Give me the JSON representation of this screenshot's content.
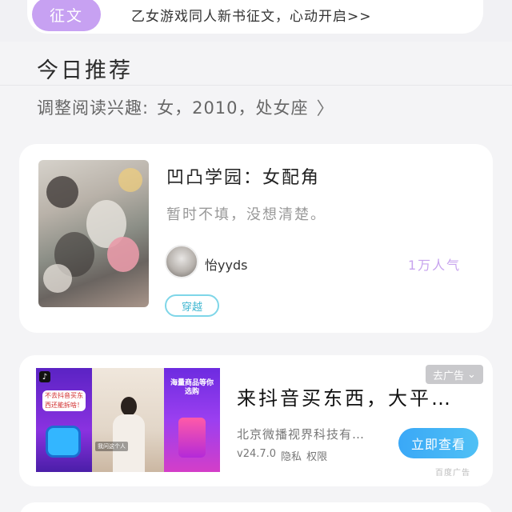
{
  "top_banner": {
    "tag": "征文",
    "text": "乙女游戏同人新书征文，心动开启>>"
  },
  "section": {
    "title": "今日推荐",
    "interest_prefix": "调整阅读兴趣:",
    "interest_values": "女，2010，处女座",
    "chevron_icon": "chevron-right-icon"
  },
  "book": {
    "title": "凹凸学园：女配角",
    "description": "暂时不填，没想清楚。",
    "author": "怡yyds",
    "popularity": "1万人气",
    "genre": "穿越"
  },
  "ad": {
    "close_label": "去广告",
    "title": "来抖音买东西，大平…",
    "company": "北京微播视界科技有…",
    "version": "v24.7.0",
    "privacy": "隐私",
    "permissions": "权限",
    "cta": "立即查看",
    "source": "百度广告",
    "image_texts": {
      "left_bubble": "不去抖音买东西还能拆啥！",
      "middle_caption": "我问这个人",
      "right_text": "海量商品等你选购"
    }
  },
  "colors": {
    "accent_purple": "#c7a1f2",
    "genre_cyan": "#42b8d2",
    "cta_blue": "#3aa8f7"
  }
}
